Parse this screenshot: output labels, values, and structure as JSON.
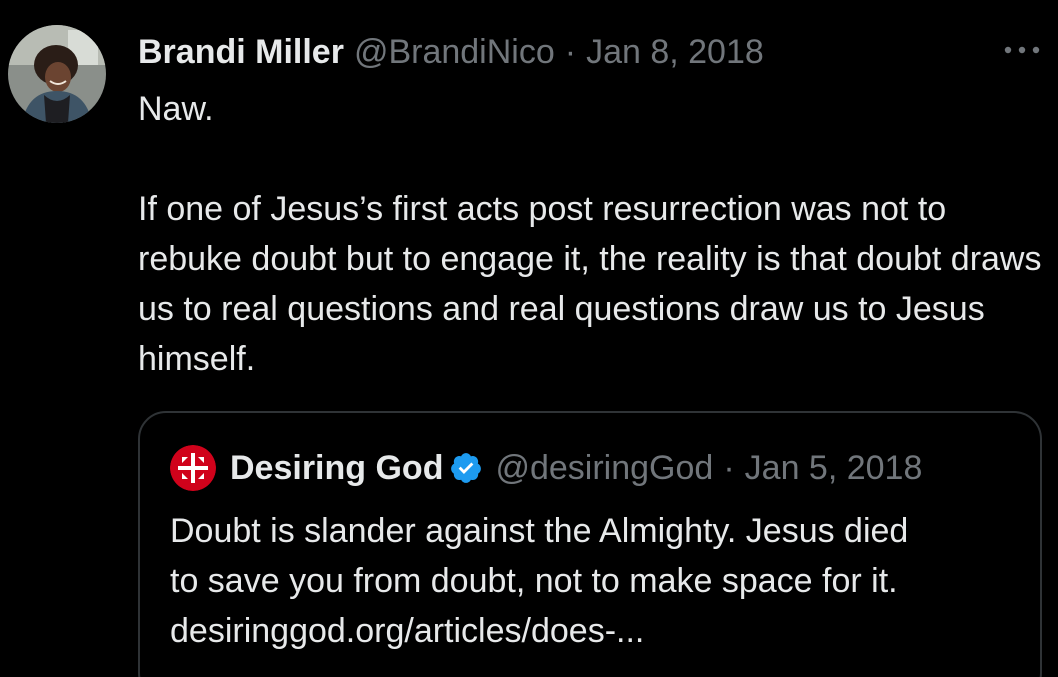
{
  "tweet": {
    "author_name": "Brandi Miller",
    "handle": "@BrandiNico",
    "separator": "·",
    "date": "Jan 8, 2018",
    "text": "Naw.\n\nIf one of Jesus’s first acts post resurrection was not to rebuke doubt but to engage it, the reality is that doubt draws us to real questions and real questions draw us to Jesus himself.",
    "more_icon": "more-horizontal-icon",
    "avatar_icon": "user-avatar"
  },
  "quote": {
    "author_name": "Desiring God",
    "handle": "@desiringGod",
    "separator": "·",
    "date": "Jan 5, 2018",
    "verified_icon": "verified-badge-icon",
    "logo_icon": "desiring-god-logo",
    "text_lines": [
      "Doubt is slander against the Almighty. Jesus died",
      "to save you from doubt, not to make space for it.",
      "desiringgod.org/articles/does-..."
    ]
  },
  "colors": {
    "background": "#000000",
    "text_primary": "#e7e9ea",
    "text_secondary": "#71767b",
    "border": "#2f3336",
    "verified_blue": "#1d9bf0",
    "logo_red": "#d0021b"
  }
}
